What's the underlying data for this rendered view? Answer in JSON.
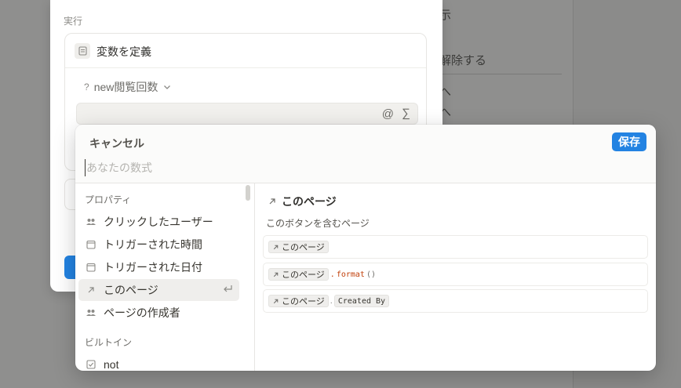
{
  "background": {
    "right_texts": [
      "示",
      "解除する",
      "へ",
      "へ"
    ]
  },
  "modal": {
    "section_label": "実行",
    "action_title": "変数を定義",
    "variable_name": "new閲覧回数",
    "variable_prefix": "?"
  },
  "popup": {
    "cancel_label": "キャンセル",
    "save_label": "保存",
    "formula_placeholder": "あなたの数式",
    "groups": {
      "properties_label": "プロパティ",
      "builtin_label": "ビルトイン"
    },
    "items": [
      {
        "label": "クリックしたユーザー",
        "icon": "people-icon"
      },
      {
        "label": "トリガーされた時間",
        "icon": "calendar-icon"
      },
      {
        "label": "トリガーされた日付",
        "icon": "calendar-icon"
      },
      {
        "label": "このページ",
        "icon": "arrow-up-right-icon",
        "active": true
      },
      {
        "label": "ページの作成者",
        "icon": "people-icon"
      },
      {
        "label": "not",
        "icon": "checkbox-icon"
      }
    ],
    "detail": {
      "title": "このページ",
      "description": "このボタンを含むページ",
      "examples": [
        {
          "chip": "このページ",
          "suffix_dot": "",
          "suffix_code": "",
          "suffix_paren": "",
          "suffix_chip": ""
        },
        {
          "chip": "このページ",
          "suffix_dot": ".",
          "suffix_code": "format",
          "suffix_paren": "()",
          "suffix_chip": ""
        },
        {
          "chip": "このページ",
          "suffix_dot": ".",
          "suffix_code": "",
          "suffix_paren": "",
          "suffix_chip": "Created By"
        }
      ]
    }
  },
  "colors": {
    "accent": "#2383e2",
    "overlay": "#8e8e8e"
  }
}
